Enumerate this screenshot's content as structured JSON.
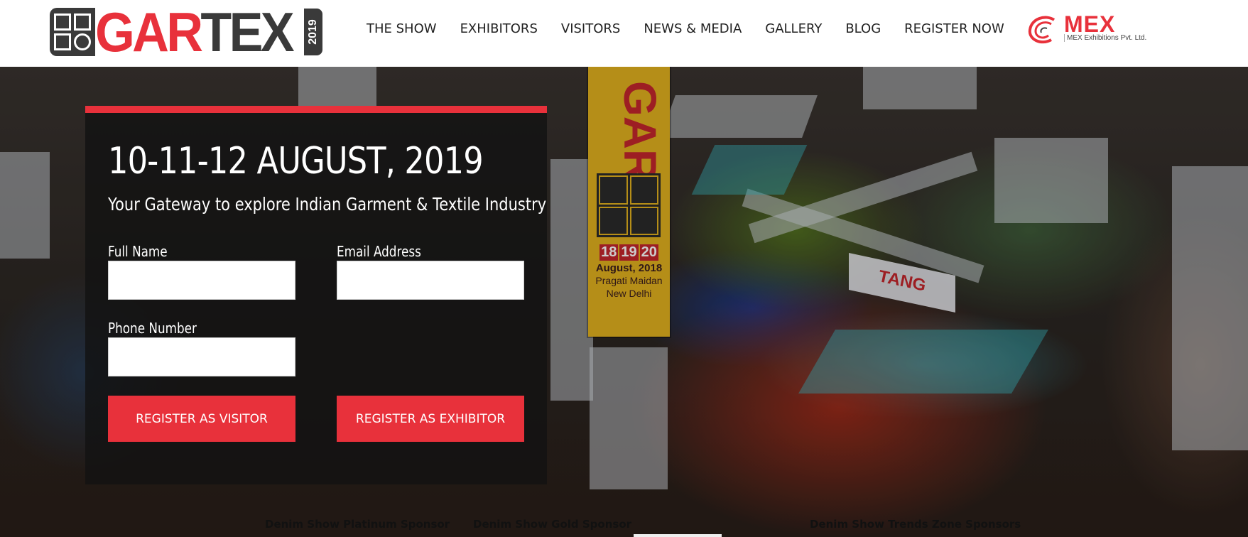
{
  "header": {
    "logo": {
      "word_part1": "GAR",
      "word_part2": "TEX",
      "year": "2019"
    },
    "nav": [
      {
        "label": "THE SHOW"
      },
      {
        "label": "EXHIBITORS"
      },
      {
        "label": "VISITORS"
      },
      {
        "label": "NEWS & MEDIA"
      },
      {
        "label": "GALLERY"
      },
      {
        "label": "BLOG"
      },
      {
        "label": "REGISTER NOW"
      }
    ],
    "partner_logo": {
      "word": "MEX",
      "subtitle": "MEX Exhibitions Pvt. Ltd."
    }
  },
  "hero": {
    "banner": {
      "letters": "GAR",
      "days": [
        "18",
        "19",
        "20"
      ],
      "month": "August, 2018",
      "place_line1": "Pragati Maidan",
      "place_line2": "New Delhi"
    },
    "booth_sign": "TANG"
  },
  "form": {
    "date": "10-11-12 AUGUST, 2019",
    "tagline": "Your Gateway to explore Indian Garment & Textile Industry",
    "full_name": {
      "label": "Full Name",
      "value": ""
    },
    "email": {
      "label": "Email Address",
      "value": ""
    },
    "phone": {
      "label": "Phone Number",
      "value": ""
    },
    "visitor_button": "REGISTER AS VISITOR",
    "exhibitor_button": "REGISTER AS EXHIBITOR"
  },
  "sponsors": [
    {
      "label": "Denim Show Platinum Sponsor"
    },
    {
      "label": "Denim Show Gold Sponsor"
    },
    {
      "label": "Denim Show Trends Zone Sponsors"
    }
  ],
  "colors": {
    "accent": "#e8313b",
    "logo_dark": "#3a3a3a",
    "banner_yellow": "#e3b21f"
  }
}
